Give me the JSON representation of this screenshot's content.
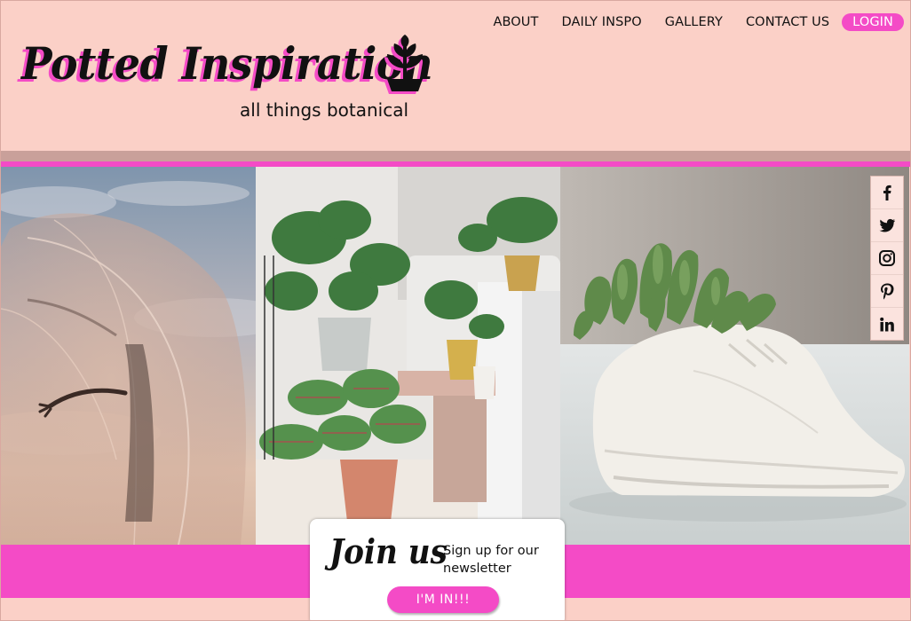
{
  "colors": {
    "background": "#fbd0c7",
    "accent": "#f44bc6",
    "text": "#111111"
  },
  "nav": {
    "about": "ABOUT",
    "daily": "DAILY INSPO",
    "gallery": "GALLERY",
    "contact": "CONTACT US",
    "login": "LOGIN"
  },
  "brand": {
    "title": "Potted Inspiration",
    "tagline": "all things botanical",
    "logo_icon": "potted-plant-icon"
  },
  "hero": {
    "images": [
      {
        "name": "hero-image-tulle",
        "subject": "figure draped in sheer tulle against a sunset sky"
      },
      {
        "name": "hero-image-houseplants",
        "subject": "houseplants in pots beside a white sofa"
      },
      {
        "name": "hero-image-sneaker-planter",
        "subject": "succulent planted in a white sneaker planter"
      }
    ]
  },
  "social": [
    "facebook-icon",
    "twitter-icon",
    "instagram-icon",
    "pinterest-icon",
    "linkedin-icon"
  ],
  "newsletter": {
    "title": "Join us",
    "text": "Sign up for our newsletter",
    "button": "I'M IN!!!"
  }
}
